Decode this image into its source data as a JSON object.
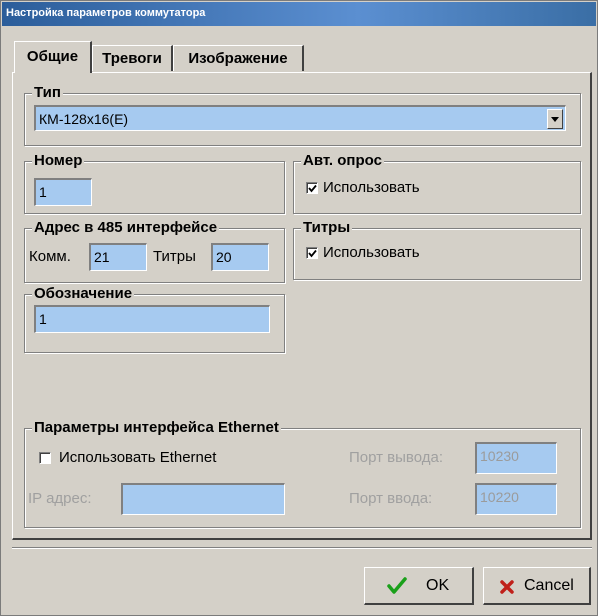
{
  "window": {
    "title": "Настройка параметров коммутатора"
  },
  "tabs": [
    {
      "label": "Общие",
      "active": true
    },
    {
      "label": "Тревоги",
      "active": false
    },
    {
      "label": "Изображение",
      "active": false
    }
  ],
  "type_group": {
    "legend": "Тип",
    "selected": "КМ-128x16(E)"
  },
  "number_group": {
    "legend": "Номер",
    "value": "1"
  },
  "auto_poll": {
    "legend": "Авт. опрос",
    "checkbox_label": "Использовать",
    "checked": true
  },
  "address_group": {
    "legend": "Адрес в 485 интерфейсе",
    "comm_label": "Комм.",
    "comm_value": "21",
    "titles_label": "Титры",
    "titles_value": "20"
  },
  "titles_group": {
    "legend": "Титры",
    "checkbox_label": "Использовать",
    "checked": true
  },
  "designation_group": {
    "legend": "Обозначение",
    "value": "1"
  },
  "ethernet_group": {
    "legend": "Параметры интерфейса Ethernet",
    "use_label": "Использовать Ethernet",
    "use_checked": false,
    "ip_label": "IP адрес:",
    "ip_value": "",
    "out_port_label": "Порт вывода:",
    "out_port_value": "10230",
    "in_port_label": "Порт ввода:",
    "in_port_value": "10220"
  },
  "buttons": {
    "ok": "OK",
    "cancel": "Cancel"
  },
  "colors": {
    "face": "#d4d0c8",
    "field": "#a6caf0",
    "title_bar": "#3a6ea5",
    "ok_check": "#1aa01a",
    "cancel_x": "#c0201a"
  }
}
